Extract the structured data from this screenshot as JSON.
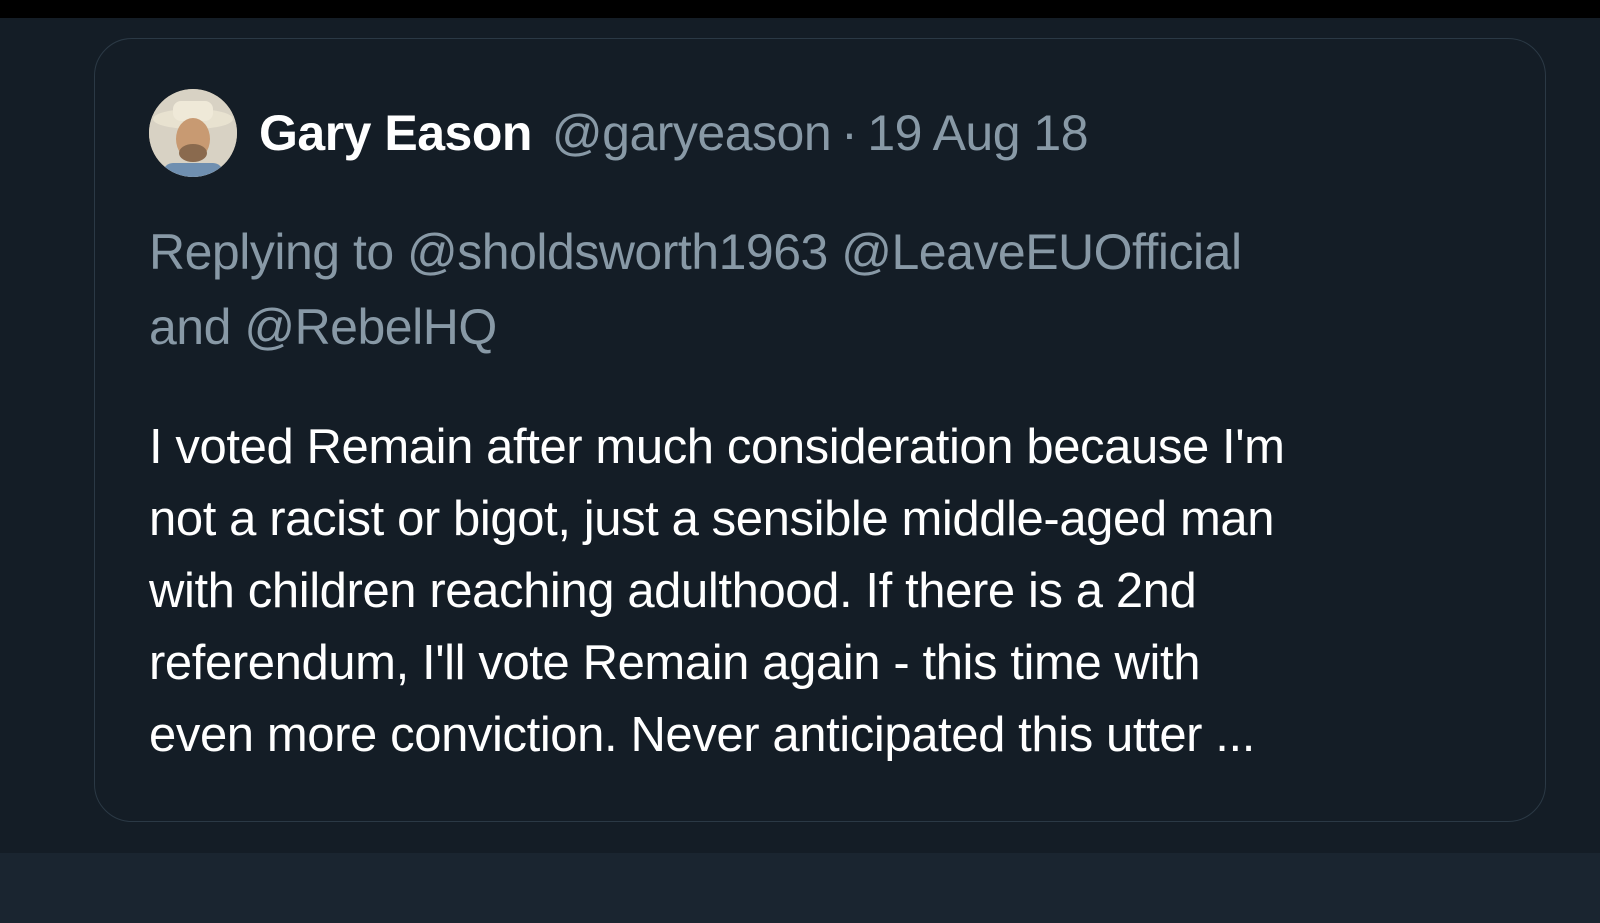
{
  "tweet": {
    "author_name": "Gary Eason",
    "handle": "@garyeason",
    "separator": "·",
    "date": "19 Aug 18",
    "reply_line_1": "Replying to @sholdsworth1963 @LeaveEUOfficial",
    "reply_line_2": "and @RebelHQ",
    "text_line_1": "I voted Remain after much consideration because I'm",
    "text_line_2": "not a racist or bigot, just a sensible middle-aged man",
    "text_line_3": "with children reaching adulthood. If there is a 2nd",
    "text_line_4": "referendum, I'll vote Remain again - this time with",
    "text_line_5": "even more conviction. Never anticipated this utter ..."
  },
  "colors": {
    "background": "#141d26",
    "card_border": "#2b3945",
    "primary_text": "#ffffff",
    "secondary_text": "#8899a6"
  },
  "icons": {
    "avatar": "profile-photo-avatar"
  }
}
